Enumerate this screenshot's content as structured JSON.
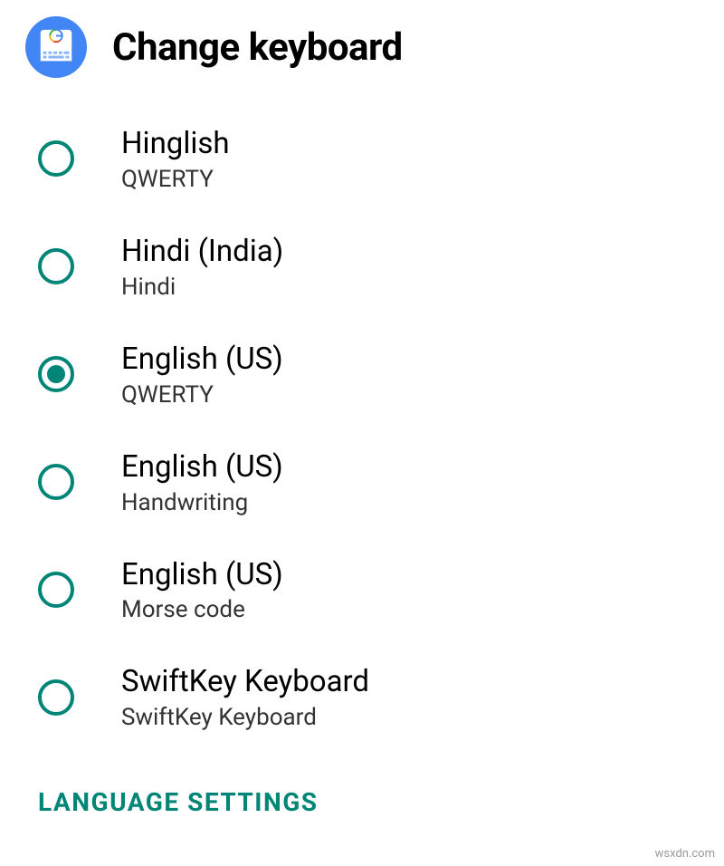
{
  "header": {
    "title": "Change keyboard",
    "icon_name": "gboard-app-icon"
  },
  "keyboards": [
    {
      "label": "Hinglish",
      "sublabel": "QWERTY",
      "selected": false
    },
    {
      "label": "Hindi (India)",
      "sublabel": "Hindi",
      "selected": false
    },
    {
      "label": "English (US)",
      "sublabel": "QWERTY",
      "selected": true
    },
    {
      "label": "English (US)",
      "sublabel": "Handwriting",
      "selected": false
    },
    {
      "label": "English (US)",
      "sublabel": "Morse code",
      "selected": false
    },
    {
      "label": "SwiftKey Keyboard",
      "sublabel": "SwiftKey Keyboard",
      "selected": false
    }
  ],
  "section_header": "LANGUAGE SETTINGS",
  "watermark": "wsxdn.com",
  "colors": {
    "accent": "#008577",
    "app_icon_bg": "#4285f4"
  }
}
